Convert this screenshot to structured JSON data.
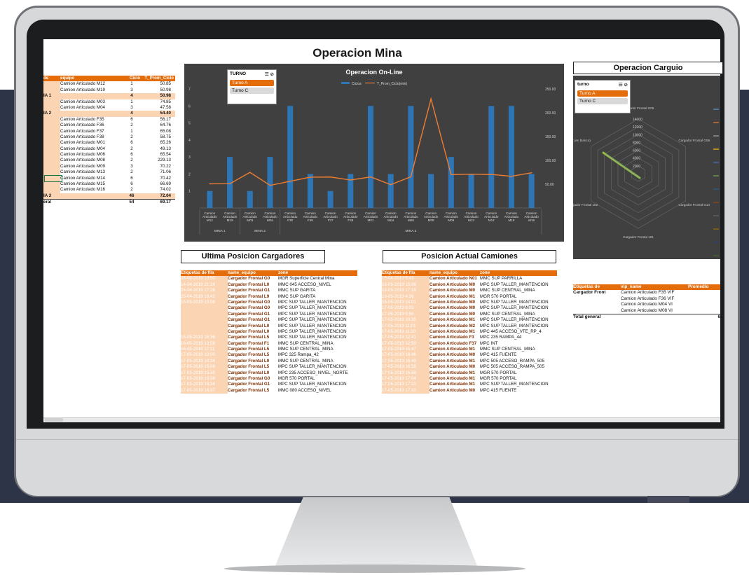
{
  "page": {
    "title": "Operacion Mina"
  },
  "colors": {
    "accent": "#e46c0a",
    "peach": "#fbd4b4",
    "chart_bg": "#404040",
    "bar": "#2e75b6",
    "line": "#ed7d31"
  },
  "left_pivot": {
    "headers": [
      "de",
      "equipo",
      "Ciclo",
      "T_Prom_Ciclo"
    ],
    "rows": [
      {
        "g": "",
        "e": "Camion Articulado M12",
        "c": "1",
        "t": "50.85",
        "type": "row"
      },
      {
        "g": "",
        "e": "Camion Articulado M19",
        "c": "3",
        "t": "50.98",
        "type": "row"
      },
      {
        "g": "IA 1",
        "e": "",
        "c": "4",
        "t": "50.98",
        "type": "sub"
      },
      {
        "g": "",
        "e": "Camion Articulado M03",
        "c": "1",
        "t": "74.85",
        "type": "row"
      },
      {
        "g": "",
        "e": "Camion Articulado M04",
        "c": "3",
        "t": "47.58",
        "type": "row"
      },
      {
        "g": "IA 2",
        "e": "",
        "c": "4",
        "t": "54.40",
        "type": "sub"
      },
      {
        "g": "",
        "e": "Camion Articulado F35",
        "c": "6",
        "t": "56.17",
        "type": "row"
      },
      {
        "g": "",
        "e": "Camion Articulado F36",
        "c": "2",
        "t": "64.76",
        "type": "row"
      },
      {
        "g": "",
        "e": "Camion Articulado F37",
        "c": "1",
        "t": "65.08",
        "type": "row"
      },
      {
        "g": "",
        "e": "Camion Articulado F38",
        "c": "2",
        "t": "58.75",
        "type": "row"
      },
      {
        "g": "",
        "e": "Camion Articulado M01",
        "c": "6",
        "t": "65.26",
        "type": "row"
      },
      {
        "g": "",
        "e": "Camion Articulado M04",
        "c": "2",
        "t": "49.13",
        "type": "row"
      },
      {
        "g": "",
        "e": "Camion Articulado M06",
        "c": "6",
        "t": "65.54",
        "type": "row"
      },
      {
        "g": "",
        "e": "Camion Articulado M08",
        "c": "2",
        "t": "229.13",
        "type": "row"
      },
      {
        "g": "",
        "e": "Camion Articulado M09",
        "c": "3",
        "t": "70.22",
        "type": "row"
      },
      {
        "g": "",
        "e": "Camion Articulado M13",
        "c": "2",
        "t": "71.06",
        "type": "row"
      },
      {
        "g": "",
        "e": "Camion Articulado M14",
        "c": "6",
        "t": "70.42",
        "type": "row"
      },
      {
        "g": "",
        "e": "Camion Articulado M15",
        "c": "6",
        "t": "66.69",
        "type": "row"
      },
      {
        "g": "",
        "e": "Camion Articulado M16",
        "c": "2",
        "t": "74.02",
        "type": "row"
      },
      {
        "g": "IA 3",
        "e": "",
        "c": "46",
        "t": "72.04",
        "type": "sub"
      },
      {
        "g": "eral",
        "e": "",
        "c": "54",
        "t": "69.17",
        "type": "total"
      }
    ]
  },
  "turno_slicer": {
    "title": "TURNO",
    "items": [
      "Turno A",
      "Turno C"
    ]
  },
  "carguio_slicer": {
    "title": "turno",
    "items": [
      "Turno A",
      "Turno C"
    ]
  },
  "chart_data": [
    {
      "type": "bar",
      "title": "Operacion On-Line",
      "series": [
        {
          "name": "Ciclos",
          "type": "bar",
          "values": [
            1,
            3,
            1,
            3,
            6,
            2,
            1,
            2,
            6,
            2,
            6,
            2,
            3,
            2,
            6,
            6,
            2
          ]
        },
        {
          "name": "T_Prom_Ciclo(min)",
          "type": "line",
          "axis": "right",
          "values": [
            50.85,
            50.98,
            74.85,
            47.58,
            56.17,
            64.76,
            65.08,
            58.75,
            65.26,
            49.13,
            65.54,
            229.13,
            70.22,
            71.06,
            70.42,
            66.69,
            74.02
          ]
        }
      ],
      "categories": [
        "Camion Articulado M12",
        "Camion Articulado M19",
        "Camion Articulado M03",
        "Camion Articulado M04",
        "Camion Articulado F35",
        "Camion Articulado F36",
        "Camion Articulado F37",
        "Camion Articulado F38",
        "Camion Articulado M01",
        "Camion Articulado M04",
        "Camion Articulado M06",
        "Camion Articulado M08",
        "Camion Articulado M09",
        "Camion Articulado M13",
        "Camion Articulado M14",
        "Camion Articulado M15",
        "Camion Articulado M16"
      ],
      "category_labels": [
        "M12",
        "M19",
        "M03",
        "M04",
        "F35",
        "F36",
        "F37",
        "F38",
        "M01",
        "M04",
        "M06",
        "M08",
        "M09",
        "M13",
        "M14",
        "M15",
        "M16"
      ],
      "groups": [
        {
          "name": "MINA 1",
          "count": 2
        },
        {
          "name": "MINA 2",
          "count": 2
        },
        {
          "name": "MINA 3",
          "count": 13
        }
      ],
      "y_left": {
        "min": 0,
        "max": 7,
        "ticks": [
          "1",
          "2",
          "3",
          "4",
          "5",
          "6",
          "7"
        ]
      },
      "y_right": {
        "min": 0,
        "max": 250,
        "ticks": [
          "50.00",
          "100.00",
          "150.00",
          "200.00",
          "250.00"
        ]
      },
      "legend": "top",
      "grid": false
    },
    {
      "type": "radar",
      "title": "Operacion Carguio",
      "axes": [
        "Cargador Frontal G05",
        "Cargador Frontal G09",
        "Cargador Frontal G14",
        "Cargador Frontal 101",
        "Cargador Frontal 102",
        "(en blanco)"
      ],
      "ticks": [
        "2000",
        "4000",
        "6000",
        "8000",
        "10000",
        "12000",
        "14000"
      ],
      "legend": "right"
    }
  ],
  "cargadores": {
    "title": "Ultima Posicion Cargadores",
    "headers": [
      "Etiquetas de fila",
      "name_equipo",
      "zone"
    ],
    "rows": [
      [
        "03-09-2019 10:50",
        "Cargador Frontal G0",
        "MGR Superficie Central Mina"
      ],
      [
        "14-04-2019 21:24",
        "Cargador Frontal L0",
        "MMC 045 ACCESO_NIVEL"
      ],
      [
        "24-04-2019 17:26",
        "Cargador Frontal G1",
        "MMC SUP GARITA"
      ],
      [
        "25-04-2019 16:42",
        "Cargador Frontal L9",
        "MMC SUP GARITA"
      ],
      [
        "15-05-2019 15:08",
        "Cargador Frontal G0",
        "MPC SUP TALLER_MANTENCION"
      ],
      [
        "",
        "Cargador Frontal G0",
        "MPC SUP TALLER_MANTENCION"
      ],
      [
        "",
        "Cargador Frontal G1",
        "MPC SUP TALLER_MANTENCION"
      ],
      [
        "",
        "Cargador Frontal G1",
        "MPC SUP TALLER_MANTENCION"
      ],
      [
        "",
        "Cargador Frontal L0",
        "MPC SUP TALLER_MANTENCION"
      ],
      [
        "",
        "Cargador Frontal L0",
        "MPC SUP TALLER_MANTENCION"
      ],
      [
        "15-05-2019 16:36",
        "Cargador Frontal L5",
        "MPC SUP TALLER_MANTENCION"
      ],
      [
        "16-05-2019 13:58",
        "Cargador Frontal F1",
        "MMC SUP CENTRAL_MINA"
      ],
      [
        "16-05-2019 17:11",
        "Cargador Frontal L5",
        "MMC SUP CENTRAL_MINA"
      ],
      [
        "17-05-2019 12:00",
        "Cargador Frontal L5",
        "MPC 325 Rampa_42"
      ],
      [
        "17-05-2019 14:34",
        "Cargador Frontal L0",
        "MMC SUP CENTRAL_MINA"
      ],
      [
        "17-05-2019 15:08",
        "Cargador Frontal L5",
        "MPC SUP TALLER_MANTENCION"
      ],
      [
        "17-05-2019 15:35",
        "Cargador Frontal L0",
        "MPC 235 ACCESO_NIVEL_NORTE"
      ],
      [
        "17-05-2019 15:38",
        "Cargador Frontal G0",
        "MGR 570 PORTAL"
      ],
      [
        "17-05-2019 16:34",
        "Cargador Frontal G1",
        "MPC SUP TALLER_MANTENCION"
      ],
      [
        "17-05-2019 16:37",
        "Cargador Frontal L5",
        "MMC 080 ACCESO_NIVEL"
      ]
    ]
  },
  "camiones": {
    "title": "Posicion Actual Camiones",
    "headers": [
      "Etiquetas de fila",
      "name_equipo",
      "zone"
    ],
    "rows": [
      [
        "15-04-2019 5:43",
        "Camion Articulado N01",
        "MMC SUP PARRILLA"
      ],
      [
        "15-05-2019 15:08",
        "Camion Articulado M0",
        "MPC SUP TALLER_MANTENCION"
      ],
      [
        "15-05-2019 17:18",
        "Camion Articulado M0",
        "MMC SUP CENTRAL_MINA"
      ],
      [
        "16-05-2019 4:36",
        "Camion Articulado M1",
        "MGR 570 PORTAL"
      ],
      [
        "16-05-2019 14:01",
        "Camion Articulado M0",
        "MPC SUP TALLER_MANTENCION"
      ],
      [
        "17-05-2019 8:05",
        "Camion Articulado M0",
        "MPC SUP TALLER_MANTENCION"
      ],
      [
        "17-05-2019 9:50",
        "Camion Articulado M0",
        "MMC SUP CENTRAL_MINA"
      ],
      [
        "17-05-2019 10:35",
        "Camion Articulado M1",
        "MPC SUP TALLER_MANTENCION"
      ],
      [
        "17-05-2019 11:01",
        "Camion Articulado M2",
        "MPC SUP TALLER_MANTENCION"
      ],
      [
        "17-05-2019 11:20",
        "Camion Articulado M1",
        "MPC 445 ACCESO_VTE_RP_4"
      ],
      [
        "17-05-2019 12:41",
        "Camion Articulado F3",
        "MPC 235 RAMPA_44"
      ],
      [
        "17-05-2019 12:50",
        "Camion Articulado F37",
        "MPC INT"
      ],
      [
        "17-05-2019 15:47",
        "Camion Articulado M1",
        "MMC SUP CENTRAL_MINA"
      ],
      [
        "17-05-2019 16:46",
        "Camion Articulado M0",
        "MPC 415 FUENTE"
      ],
      [
        "17-05-2019 16:49",
        "Camion Articulado M1",
        "MPC 505 ACCESO_RAMPA_505"
      ],
      [
        "17-05-2019 16:56",
        "Camion Articulado M0",
        "MPC 505 ACCESO_RAMPA_505"
      ],
      [
        "17-05-2019 16:59",
        "Camion Articulado M1",
        "MGR 570 PORTAL"
      ],
      [
        "17-05-2019 17:04",
        "Camion Articulado M1",
        "MGR 570 PORTAL"
      ],
      [
        "17-05-2019 17:10",
        "Camion Articulado M1",
        "MPC SUP TALLER_MANTENCION"
      ],
      [
        "17-05-2019 17:10",
        "Camion Articulado M0",
        "MPC 415 FUENTE"
      ]
    ]
  },
  "vip_pivot": {
    "headers": [
      "Etiquetas de",
      "vip_name",
      "Promedio"
    ],
    "rows": [
      [
        "Cargador Front",
        "Camion Articulado F35 VIF"
      ],
      [
        "",
        "Camion Articulado F36 VIF"
      ],
      [
        "",
        "Camion Articulado M04 VI"
      ],
      [
        "",
        "Camion Articulado M08 VI"
      ]
    ],
    "total": "Total general",
    "total_value": "6"
  }
}
